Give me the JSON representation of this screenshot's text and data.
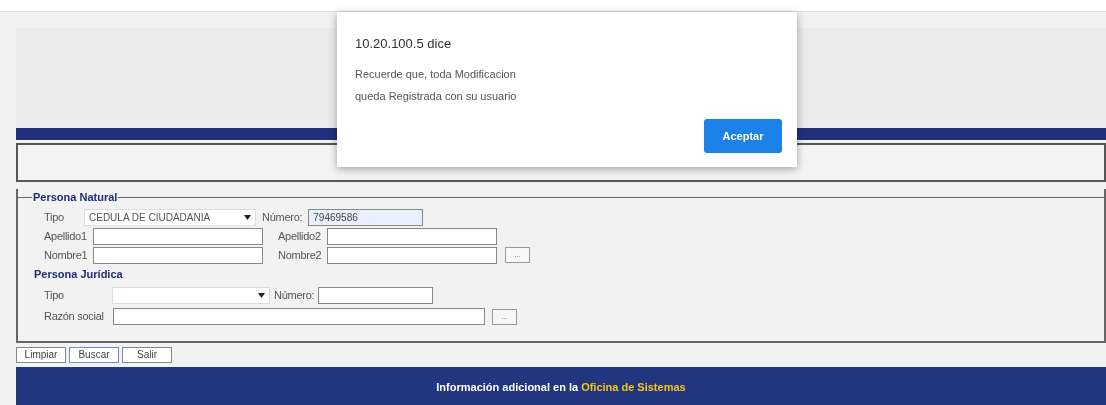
{
  "dialog": {
    "title": "10.20.100.5 dice",
    "message_lines": [
      "Recuerde que, toda Modificacion",
      "queda Registrada con su usuario"
    ],
    "button": "Aceptar"
  },
  "persona_natural": {
    "legend": "Persona Natural",
    "tipo_label": "Tipo",
    "tipo_value": "CEDULA DE CIUDADANIA",
    "numero_label": "Número:",
    "numero_value": "79469586",
    "numero_autofilled": true,
    "apellido1_label": "Apellido1",
    "apellido2_label": "Apellido2",
    "nombre1_label": "Nombre1",
    "nombre2_label": "Nombre2",
    "lookup_button": "..."
  },
  "persona_juridica": {
    "heading": "Persona Jurídica",
    "tipo_label": "Tipo",
    "numero_label": "Número:",
    "razon_label": "Razón social",
    "lookup_button": "..."
  },
  "buttons": [
    {
      "label": "Limpiar",
      "focused": false
    },
    {
      "label": "Buscar",
      "focused": true
    },
    {
      "label": "Salir",
      "focused": false
    }
  ],
  "footer": {
    "text": "Información adicional en la",
    "link": "Oficina de Sistemas"
  }
}
